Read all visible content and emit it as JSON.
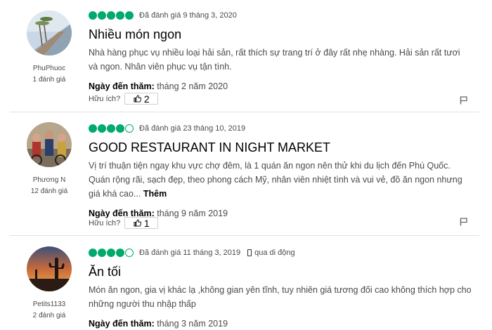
{
  "helpful_label": "Hữu ích?",
  "visit_label": "Ngày đến thăm:",
  "more_label": "Thêm",
  "colors": {
    "bubble": "#00aa6c",
    "title": "#000000",
    "text": "#4a4a4a"
  },
  "reviews": [
    {
      "user": {
        "name": "PhuPhuoc",
        "reviews_count": "1 đánh giá"
      },
      "rating": 5,
      "date": "Đã đánh giá 9 tháng 3, 2020",
      "title": "Nhiều món ngon",
      "body": "Nhà hàng phục vụ nhiều loại hải sản, rất thích sự trang trí ở đây rất nhẹ nhàng. Hải sản rất tươi và ngon. Nhân viên phục vụ tận tình.",
      "visit_date": "tháng 2 năm 2020",
      "helpful_count": "2"
    },
    {
      "user": {
        "name": "Phương N",
        "reviews_count": "12 đánh giá"
      },
      "rating": 4,
      "date": "Đã đánh giá 23 tháng 10, 2019",
      "title": "GOOD RESTAURANT IN NIGHT MARKET",
      "body": "Vị trí thuận tiện ngay khu vực chợ đêm, là 1 quán ăn ngon nên thử khi du lịch đến Phú Quốc. Quán rộng rãi, sạch đẹp, theo phong cách Mỹ, nhân viên nhiệt tình và vui vẻ, đồ ăn ngon nhưng giá khá cao...",
      "visit_date": "tháng 9 năm 2019",
      "helpful_count": "1"
    },
    {
      "user": {
        "name": "Petits1133",
        "reviews_count": "2 đánh giá"
      },
      "rating": 4,
      "date": "Đã đánh giá 11 tháng 3, 2019",
      "mobile_label": "qua di động",
      "title": "Ăn tối",
      "body": "Món ăn ngon, gia vị khác lạ ,không gian yên tĩnh, tuy nhiên giá tương đối cao không thích hợp cho những người thu nhập thấp",
      "visit_date": "tháng 3 năm 2019"
    }
  ]
}
